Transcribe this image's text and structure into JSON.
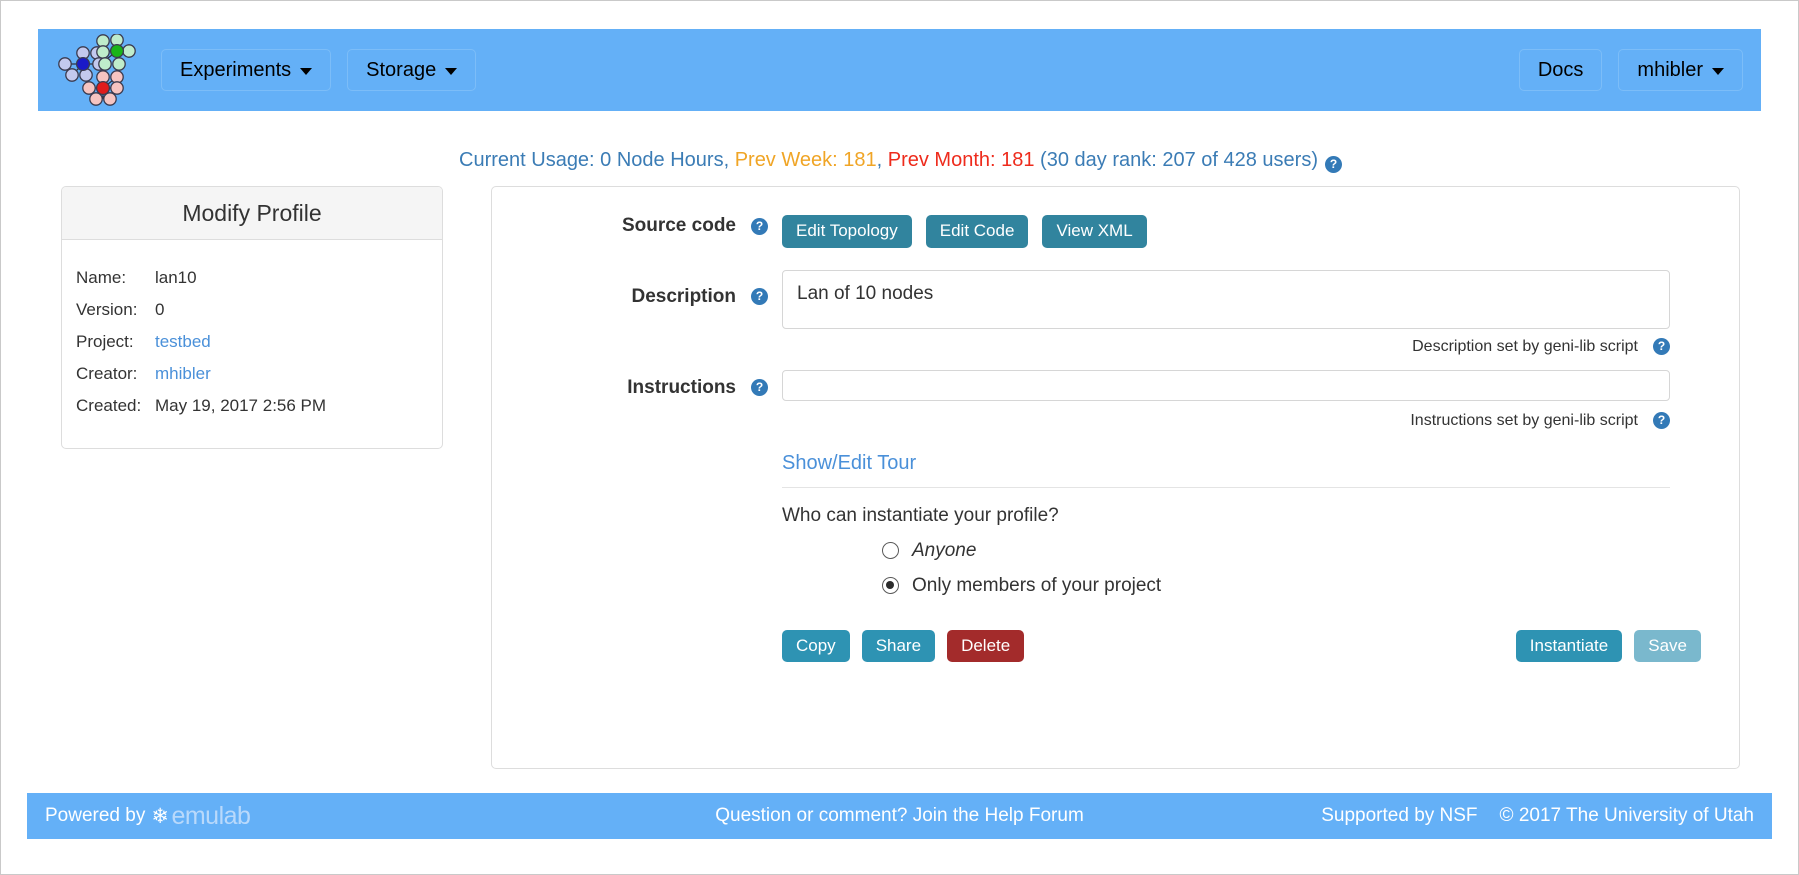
{
  "navbar": {
    "logo_name": "emulab-node-graph-logo",
    "experiments_label": "Experiments",
    "storage_label": "Storage",
    "docs_label": "Docs",
    "user_label": "mhibler"
  },
  "usage": {
    "current_prefix": "Current Usage: 0 Node Hours, ",
    "prev_week": "Prev Week: 181",
    "separator": ", ",
    "prev_month": "Prev Month: 181",
    "rank": " (30 day rank: 207 of 428 users)",
    "help_glyph": "?",
    "colors": {
      "base": "#3b7cb5",
      "warning": "#f0a526",
      "danger": "#ee2b1c"
    }
  },
  "side_panel": {
    "title": "Modify Profile",
    "rows": [
      {
        "label": "Name:",
        "value": "lan10",
        "link": false
      },
      {
        "label": "Version:",
        "value": "0",
        "link": false
      },
      {
        "label": "Project:",
        "value": "testbed",
        "link": true
      },
      {
        "label": "Creator:",
        "value": "mhibler",
        "link": true
      },
      {
        "label": "Created:",
        "value": "May 19, 2017 2:56 PM",
        "link": false
      }
    ]
  },
  "form": {
    "source_code_label": "Source code",
    "edit_topology_label": "Edit Topology",
    "edit_code_label": "Edit Code",
    "view_xml_label": "View XML",
    "description_label": "Description",
    "description_value": "Lan of 10 nodes",
    "description_note": "Description set by geni-lib script",
    "instructions_label": "Instructions",
    "instructions_value": "",
    "instructions_placeholder": "",
    "instructions_note": "Instructions set by geni-lib script",
    "tour_link": "Show/Edit Tour",
    "question": "Who can instantiate your profile?",
    "radio_anyone": "Anyone",
    "radio_members": "Only members of your project",
    "selected_radio": "members",
    "help_glyph": "?"
  },
  "actions": {
    "copy_label": "Copy",
    "share_label": "Share",
    "delete_label": "Delete",
    "instantiate_label": "Instantiate",
    "save_label": "Save"
  },
  "footer": {
    "powered_by": "Powered by",
    "brand": "emulab",
    "help": "Question or comment? Join the Help Forum",
    "nsf": "Supported by NSF",
    "copyright": "© 2017 The University of Utah"
  }
}
